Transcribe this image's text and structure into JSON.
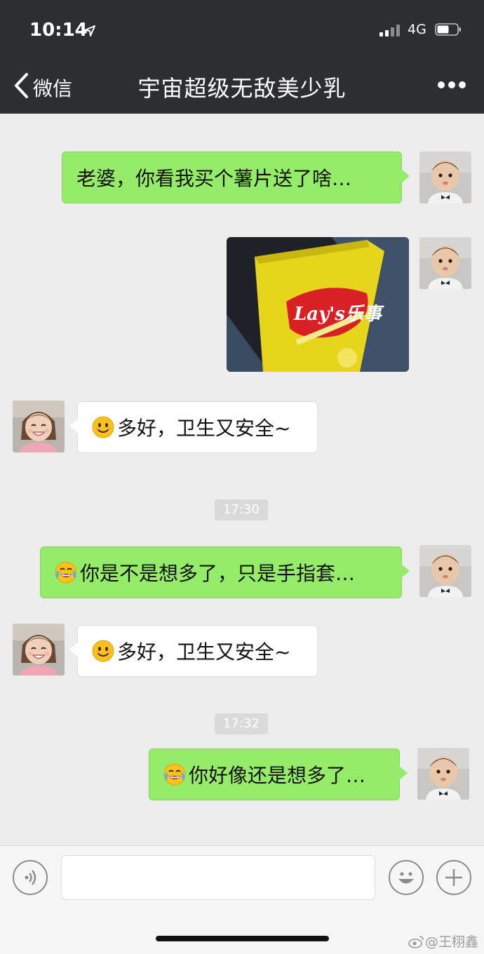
{
  "status_bar": {
    "time": "10:14",
    "network": "4G",
    "icons": [
      "location-arrow-icon",
      "signal-icon",
      "battery-icon"
    ]
  },
  "nav": {
    "back_label": "微信",
    "title": "宇宙超级无敌美少乳",
    "icons": [
      "back-chevron-icon",
      "more-dots-icon"
    ]
  },
  "messages": [
    {
      "side": "right",
      "type": "text",
      "text": "老婆，你看我买个薯片送了啥…"
    },
    {
      "side": "right",
      "type": "image",
      "image_brand_text": "Lay's乐事"
    },
    {
      "side": "left",
      "type": "text",
      "emoji": "smile-emoji",
      "text": "多好，卫生又安全~"
    },
    {
      "type": "timestamp",
      "text": "17:30"
    },
    {
      "side": "right",
      "type": "text",
      "emoji": "tears-of-joy-emoji",
      "text": "你是不是想多了，只是手指套…"
    },
    {
      "side": "left",
      "type": "text",
      "emoji": "smile-emoji",
      "text": "多好，卫生又安全~"
    },
    {
      "type": "timestamp",
      "text": "17:32"
    },
    {
      "side": "right",
      "type": "text",
      "emoji": "tears-of-joy-emoji",
      "text": "你好像还是想多了…"
    }
  ],
  "input_bar": {
    "value": "",
    "icons": [
      "voice-icon",
      "emoji-face-icon",
      "plus-icon"
    ]
  },
  "watermark": "@王栩鑫",
  "colors": {
    "header_bg": "#2d2e30",
    "chat_bg": "#ededed",
    "bubble_sent": "#95ec69",
    "bubble_received": "#ffffff"
  }
}
